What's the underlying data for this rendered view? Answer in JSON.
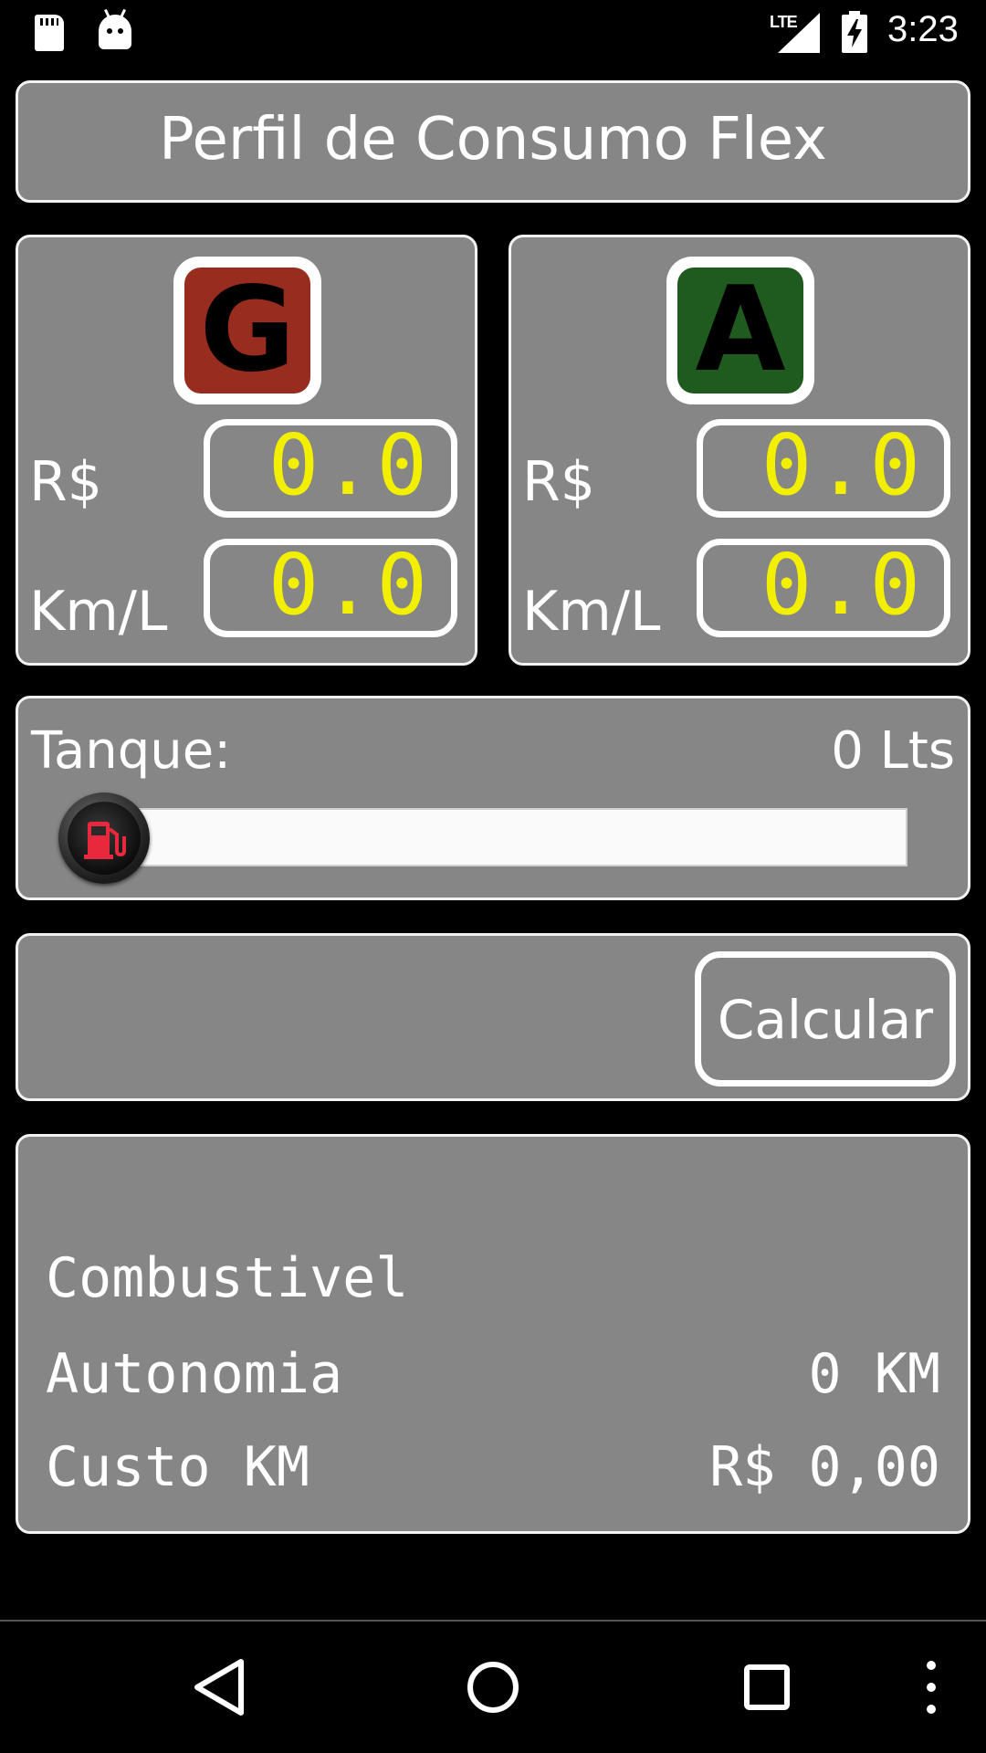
{
  "status_bar": {
    "network": "LTE",
    "time": "3:23",
    "icons": [
      "sd-card-icon",
      "android-icon",
      "signal-icon",
      "battery-charging-icon"
    ]
  },
  "app": {
    "title": "Perfil de Consumo Flex"
  },
  "gasoline": {
    "badge_letter": "G",
    "price_label": "R$",
    "price_value": "0.0",
    "efficiency_label": "Km/L",
    "efficiency_value": "0.0"
  },
  "alcohol": {
    "badge_letter": "A",
    "price_label": "R$",
    "price_value": "0.0",
    "efficiency_label": "Km/L",
    "efficiency_value": "0.0"
  },
  "tank": {
    "label": "Tanque:",
    "value_text": "0 Lts",
    "slider_fraction": 0
  },
  "actions": {
    "calculate_label": "Calcular"
  },
  "results": {
    "fuel_label": "Combustivel",
    "fuel_value": "",
    "range_label": "Autonomia",
    "range_value": "0 KM",
    "cost_label": "Custo KM",
    "cost_value": "R$ 0,00"
  },
  "colors": {
    "panel_bg": "#868686",
    "lcd_text": "#f2f000",
    "gas_badge": "#982c1e",
    "alcohol_badge": "#1f5b1e",
    "pump_icon": "#e8283c"
  },
  "navigation": {
    "buttons": [
      "back-icon",
      "home-icon",
      "recent-apps-icon",
      "overflow-menu-icon"
    ]
  }
}
